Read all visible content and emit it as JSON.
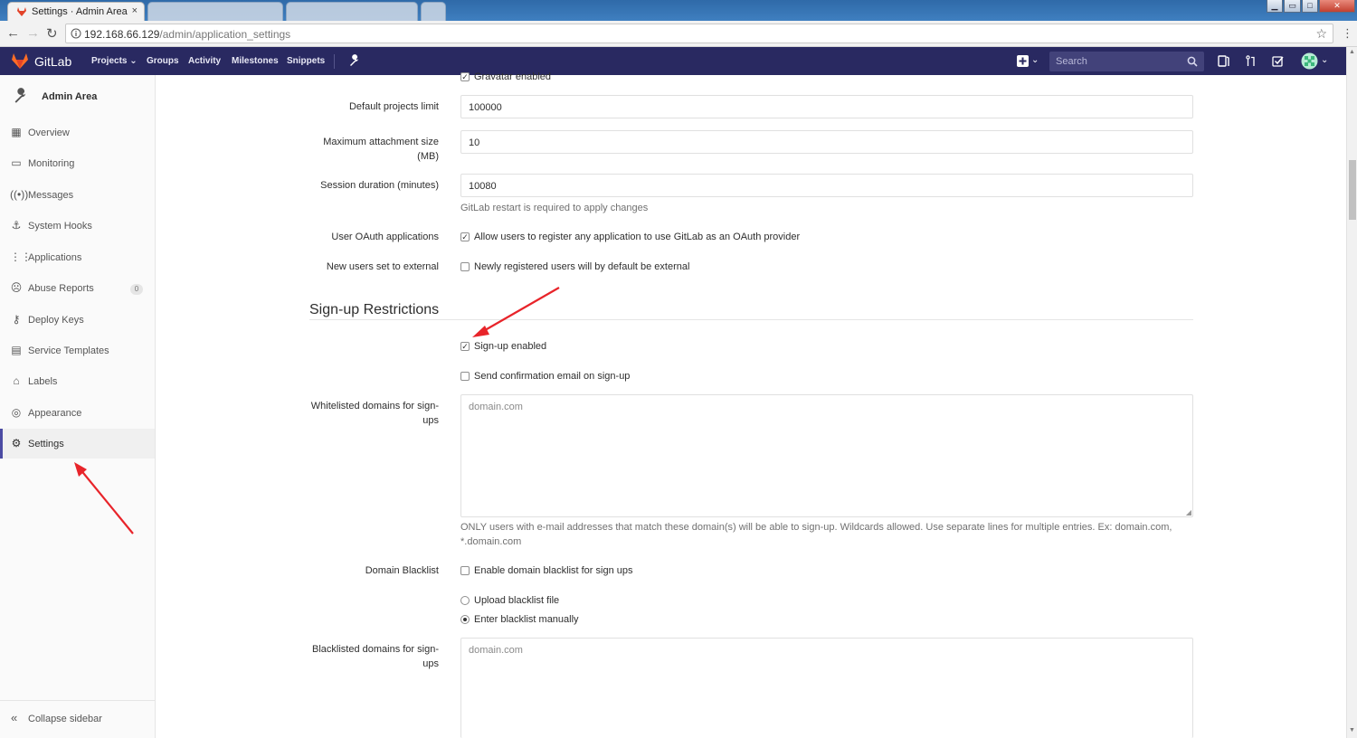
{
  "browser": {
    "active_tab_title": "Settings · Admin Area",
    "tab_close": "×",
    "url_host": "192.168.66.129",
    "url_path": "/admin/application_settings"
  },
  "header": {
    "brand": "GitLab",
    "nav": [
      "Projects",
      "Groups",
      "Activity",
      "Milestones",
      "Snippets"
    ],
    "search_placeholder": "Search",
    "bg_color": "#292961"
  },
  "sidebar": {
    "title": "Admin Area",
    "items": [
      {
        "label": "Overview",
        "icon": "overview-icon"
      },
      {
        "label": "Monitoring",
        "icon": "monitor-icon"
      },
      {
        "label": "Messages",
        "icon": "broadcast-icon"
      },
      {
        "label": "System Hooks",
        "icon": "anchor-icon"
      },
      {
        "label": "Applications",
        "icon": "grid-icon"
      },
      {
        "label": "Abuse Reports",
        "icon": "abuse-icon",
        "badge": "0"
      },
      {
        "label": "Deploy Keys",
        "icon": "key-icon"
      },
      {
        "label": "Service Templates",
        "icon": "template-icon"
      },
      {
        "label": "Labels",
        "icon": "label-icon"
      },
      {
        "label": "Appearance",
        "icon": "palette-icon"
      },
      {
        "label": "Settings",
        "icon": "gear-icon",
        "active": true
      }
    ],
    "collapse_label": "Collapse sidebar"
  },
  "form": {
    "gravatar_label": "Gravatar enabled",
    "default_projects_limit": {
      "label": "Default projects limit",
      "value": "100000"
    },
    "max_attachment_size": {
      "label": "Maximum attachment size (MB)",
      "value": "10"
    },
    "session_duration": {
      "label": "Session duration (minutes)",
      "value": "10080",
      "help": "GitLab restart is required to apply changes"
    },
    "user_oauth": {
      "label": "User OAuth applications",
      "checkbox": "Allow users to register any application to use GitLab as an OAuth provider",
      "checked": true
    },
    "new_users_external": {
      "label": "New users set to external",
      "checkbox": "Newly registered users will by default be external",
      "checked": false
    },
    "signup_section_title": "Sign-up Restrictions",
    "signup_enabled": {
      "checkbox": "Sign-up enabled",
      "checked": true
    },
    "send_confirmation": {
      "checkbox": "Send confirmation email on sign-up",
      "checked": false
    },
    "whitelisted_domains": {
      "label": "Whitelisted domains for sign-ups",
      "placeholder": "domain.com",
      "help": "ONLY users with e-mail addresses that match these domain(s) will be able to sign-up. Wildcards allowed. Use separate lines for multiple entries. Ex: domain.com, *.domain.com"
    },
    "domain_blacklist": {
      "label": "Domain Blacklist",
      "checkbox": "Enable domain blacklist for sign ups",
      "checked": false,
      "radio_upload": "Upload blacklist file",
      "radio_manual": "Enter blacklist manually",
      "selected": "manual"
    },
    "blacklisted_domains": {
      "label": "Blacklisted domains for sign-ups",
      "placeholder": "domain.com"
    }
  },
  "colors": {
    "annotation_arrow": "#e8242a",
    "accent": "#4b4ba3"
  }
}
